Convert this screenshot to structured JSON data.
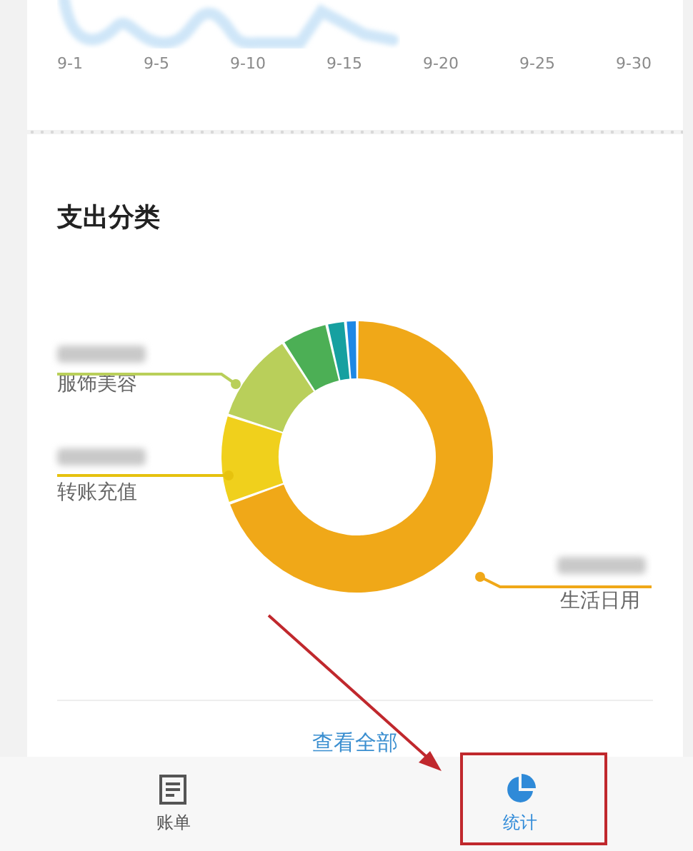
{
  "trend_chart": {
    "x_labels": [
      "9-1",
      "9-5",
      "9-10",
      "9-15",
      "9-20",
      "9-25",
      "9-30"
    ]
  },
  "expense_categories": {
    "title": "支出分类",
    "items": [
      {
        "name": "服饰美容",
        "color": "#b9cf5a"
      },
      {
        "name": "转账充值",
        "color": "#e6c20e"
      },
      {
        "name": "生活日用",
        "color": "#f0a818"
      }
    ],
    "view_all": "查看全部"
  },
  "tabs": [
    {
      "label": "账单",
      "kind": "bill",
      "selected": false
    },
    {
      "label": "统计",
      "kind": "stats",
      "selected": true
    }
  ]
}
